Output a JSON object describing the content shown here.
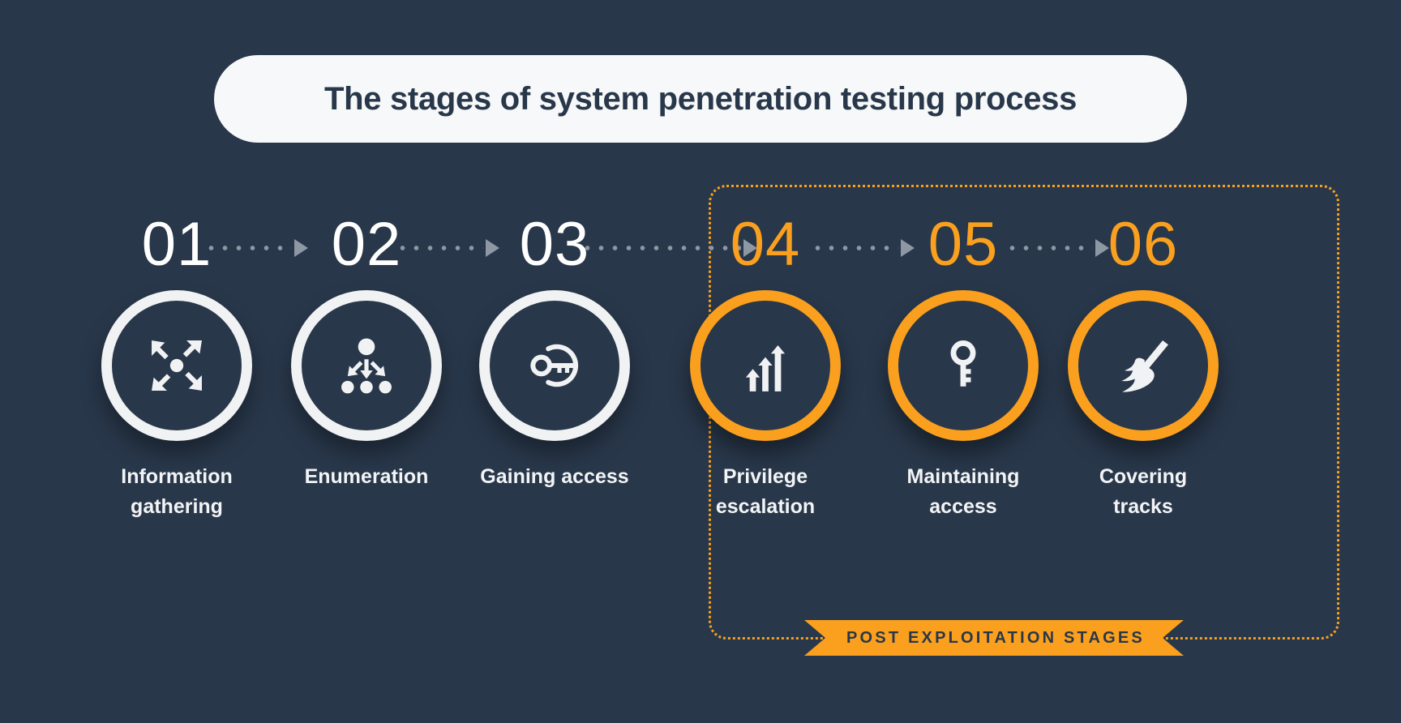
{
  "title": "The stages of system penetration testing process",
  "colors": {
    "background": "#28374a",
    "accent": "#faa01e",
    "light": "#f1f2f3",
    "title_pill": "#f7f8f9",
    "connector": "#8d98a4"
  },
  "post_exploitation": {
    "ribbon_label": "POST EXPLOITATION STAGES",
    "covers_steps": [
      "04",
      "05",
      "06"
    ]
  },
  "steps": [
    {
      "number": "01",
      "label": "Information\ngathering",
      "label_line1": "Information",
      "label_line2": "gathering",
      "icon": "converging-arrows-icon",
      "accent": false
    },
    {
      "number": "02",
      "label": "Enumeration",
      "label_line1": "Enumeration",
      "label_line2": "",
      "icon": "node-tree-icon",
      "accent": false
    },
    {
      "number": "03",
      "label": "Gaining access",
      "label_line1": "Gaining access",
      "label_line2": "",
      "icon": "key-unlock-icon",
      "accent": false
    },
    {
      "number": "04",
      "label": "Privilege\nescalation",
      "label_line1": "Privilege",
      "label_line2": "escalation",
      "icon": "rising-arrows-icon",
      "accent": true
    },
    {
      "number": "05",
      "label": "Maintaining\naccess",
      "label_line1": "Maintaining",
      "label_line2": "access",
      "icon": "key-icon",
      "accent": true
    },
    {
      "number": "06",
      "label": "Covering\ntracks",
      "label_line1": "Covering",
      "label_line2": "tracks",
      "icon": "broom-icon",
      "accent": true
    }
  ]
}
